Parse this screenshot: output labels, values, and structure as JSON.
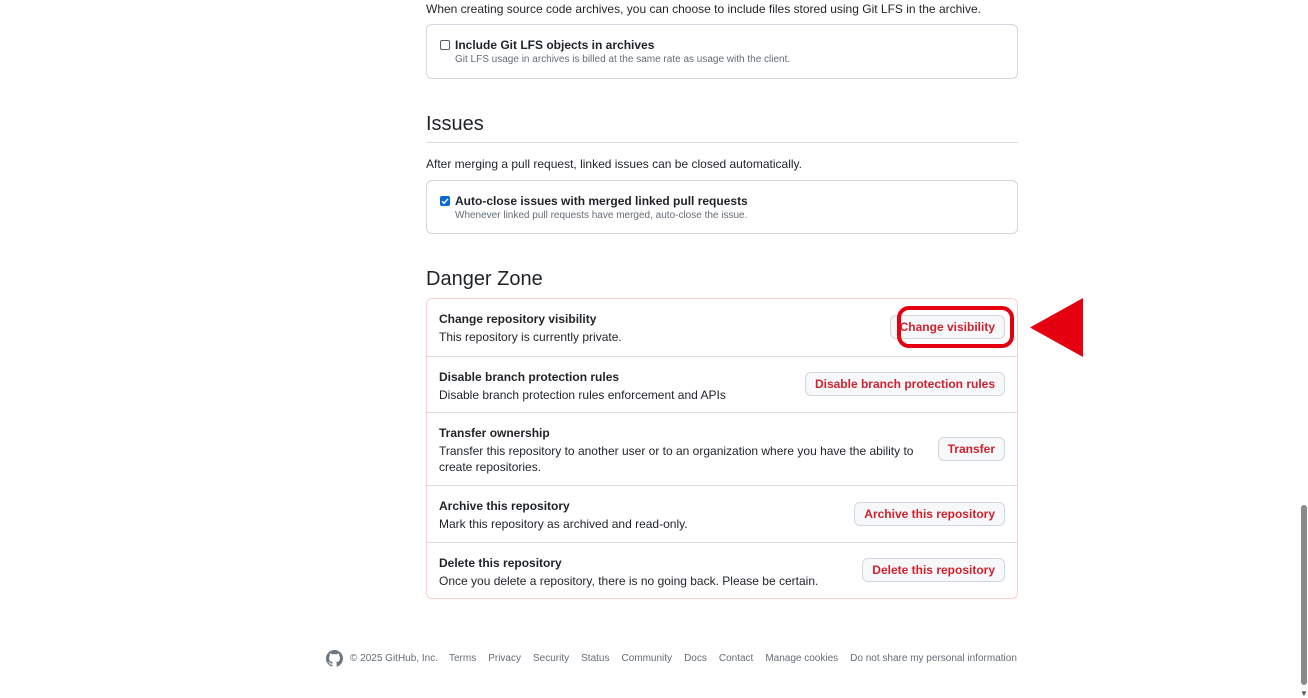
{
  "archives": {
    "intro": "When creating source code archives, you can choose to include files stored using Git LFS in the archive.",
    "option_label": "Include Git LFS objects in archives",
    "option_note": "Git LFS usage in archives is billed at the same rate as usage with the client.",
    "option_checked": false
  },
  "issues": {
    "title": "Issues",
    "description": "After merging a pull request, linked issues can be closed automatically.",
    "option_label": "Auto-close issues with merged linked pull requests",
    "option_note": "Whenever linked pull requests have merged, auto-close the issue.",
    "option_checked": true
  },
  "danger_zone": {
    "title": "Danger Zone",
    "items": [
      {
        "title": "Change repository visibility",
        "description": "This repository is currently private.",
        "button": "Change visibility"
      },
      {
        "title": "Disable branch protection rules",
        "description": "Disable branch protection rules enforcement and APIs",
        "button": "Disable branch protection rules"
      },
      {
        "title": "Transfer ownership",
        "description": "Transfer this repository to another user or to an organization where you have the ability to create repositories.",
        "button": "Transfer"
      },
      {
        "title": "Archive this repository",
        "description": "Mark this repository as archived and read-only.",
        "button": "Archive this repository"
      },
      {
        "title": "Delete this repository",
        "description": "Once you delete a repository, there is no going back. Please be certain.",
        "button": "Delete this repository"
      }
    ]
  },
  "annotation": {
    "color": "#e4000f",
    "target": "Change visibility"
  },
  "colors": {
    "danger_text": "#cf222e",
    "checkbox_checked": "#0969da",
    "border": "#d0d7de"
  },
  "footer": {
    "logo_icon": "github-mark-icon",
    "copyright": "© 2025 GitHub, Inc.",
    "links": [
      "Terms",
      "Privacy",
      "Security",
      "Status",
      "Community",
      "Docs",
      "Contact",
      "Manage cookies",
      "Do not share my personal information"
    ]
  }
}
